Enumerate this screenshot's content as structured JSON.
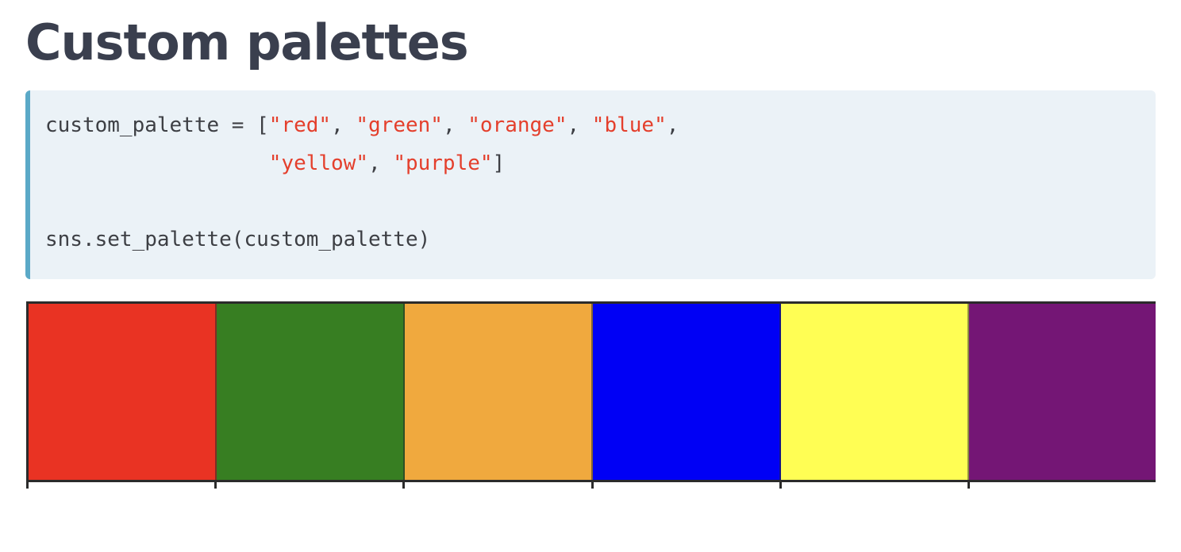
{
  "page": {
    "title": "Custom palettes"
  },
  "code": {
    "line1": {
      "lead": "custom_palette = [",
      "s1": "\"red\"",
      "sep1": ", ",
      "s2": "\"green\"",
      "sep2": ", ",
      "s3": "\"orange\"",
      "sep3": ", ",
      "s4": "\"blue\"",
      "tail": ","
    },
    "line2": {
      "indent": "                  ",
      "s5": "\"yellow\"",
      "sep5": ", ",
      "s6": "\"purple\"",
      "tail": "]"
    },
    "line3": "",
    "line4": "sns.set_palette(custom_palette)"
  },
  "palette": {
    "swatches": [
      {
        "name": "red",
        "color": "#e93323"
      },
      {
        "name": "green",
        "color": "#377e22"
      },
      {
        "name": "orange",
        "color": "#f0a93e"
      },
      {
        "name": "blue",
        "color": "#0000f5"
      },
      {
        "name": "yellow",
        "color": "#fffe54"
      },
      {
        "name": "purple",
        "color": "#741675"
      }
    ]
  },
  "colors": {
    "title_text": "#3a3f4e",
    "code_background": "#ebf2f7",
    "code_accent_border": "#5ba9c7",
    "code_text": "#3d3f44",
    "code_string": "#e43f2c"
  }
}
